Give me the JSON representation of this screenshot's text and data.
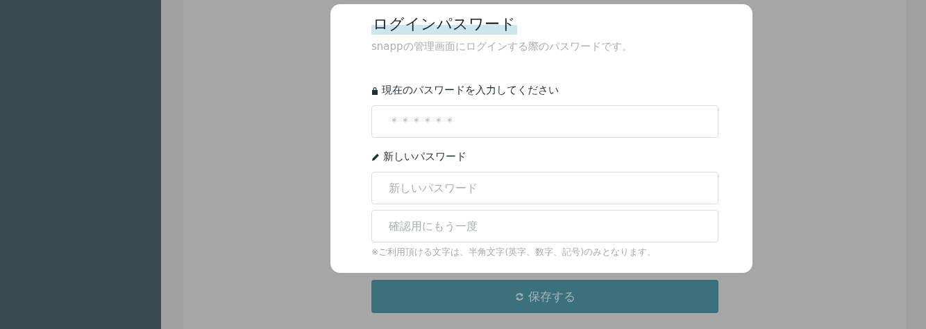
{
  "modal": {
    "title": "ログインパスワード",
    "description": "snappの管理画面にログインする際のパスワードです。",
    "current_password": {
      "label": "現在のパスワードを入力してください",
      "placeholder": "＊＊＊＊＊＊"
    },
    "new_password": {
      "label": "新しいパスワード",
      "placeholder": "新しいパスワード"
    },
    "confirm_password": {
      "placeholder": "確認用にもう一度"
    },
    "note": "※ご利用頂ける文字は、半角文字(英字、数字、記号)のみとなります。"
  },
  "save_button": {
    "label": "保存する"
  }
}
